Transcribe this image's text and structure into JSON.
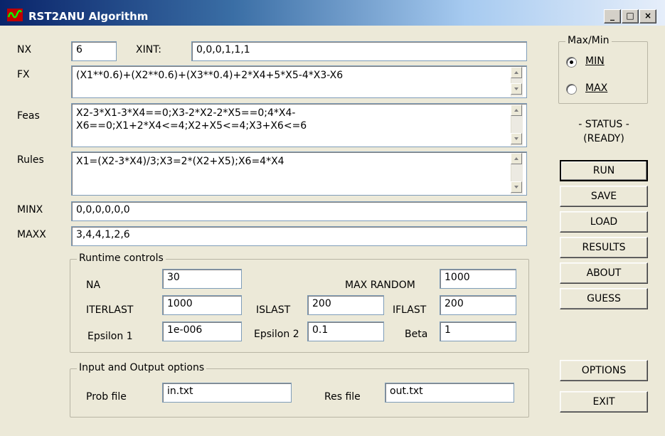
{
  "window": {
    "title": "RST2ANU Algorithm",
    "controls": [
      "_",
      "□",
      "×"
    ]
  },
  "fields": {
    "nx": {
      "label": "NX",
      "value": "6"
    },
    "xint": {
      "label": "XINT:",
      "value": "0,0,0,1,1,1"
    },
    "fx": {
      "label": "FX",
      "value": "(X1**0.6)+(X2**0.6)+(X3**0.4)+2*X4+5*X5-4*X3-X6"
    },
    "feas": {
      "label": "Feas",
      "value": "X2-3*X1-3*X4==0;X3-2*X2-2*X5==0;4*X4-X6==0;X1+2*X4<=4;X2+X5<=4;X3+X6<=6"
    },
    "rules": {
      "label": "Rules",
      "value": "X1=(X2-3*X4)/3;X3=2*(X2+X5);X6=4*X4"
    },
    "minx": {
      "label": "MINX",
      "value": "0,0,0,0,0,0"
    },
    "maxx": {
      "label": "MAXX",
      "value": "3,4,4,1,2,6"
    }
  },
  "runtime": {
    "title": "Runtime controls",
    "na": {
      "label": "NA",
      "value": "30"
    },
    "max_random": {
      "label": "MAX RANDOM",
      "value": "1000"
    },
    "iterlast": {
      "label": "ITERLAST",
      "value": "1000"
    },
    "islast": {
      "label": "ISLAST",
      "value": "200"
    },
    "iflast": {
      "label": "IFLAST",
      "value": "200"
    },
    "epsilon1": {
      "label": "Epsilon 1",
      "value": "1e-006"
    },
    "epsilon2": {
      "label": "Epsilon 2",
      "value": "0.1"
    },
    "beta": {
      "label": "Beta",
      "value": "1"
    }
  },
  "io": {
    "title": "Input and Output options",
    "prob": {
      "label": "Prob file",
      "value": "in.txt"
    },
    "res": {
      "label": "Res file",
      "value": "out.txt"
    }
  },
  "maxmin": {
    "title": "Max/Min",
    "min_label": "MIN",
    "max_label": "MAX",
    "selected": "MIN"
  },
  "status": {
    "line1": "- STATUS -",
    "line2": "(READY)"
  },
  "buttons": {
    "run": "RUN",
    "save": "SAVE",
    "load": "LOAD",
    "results": "RESULTS",
    "about": "ABOUT",
    "guess": "GUESS",
    "options": "OPTIONS",
    "exit": "EXIT"
  },
  "colors": {
    "title_bar": "#0a246a",
    "window_bg": "#ece9d8",
    "icon_bg": "#c00000",
    "icon_wave": "#00ff00"
  }
}
